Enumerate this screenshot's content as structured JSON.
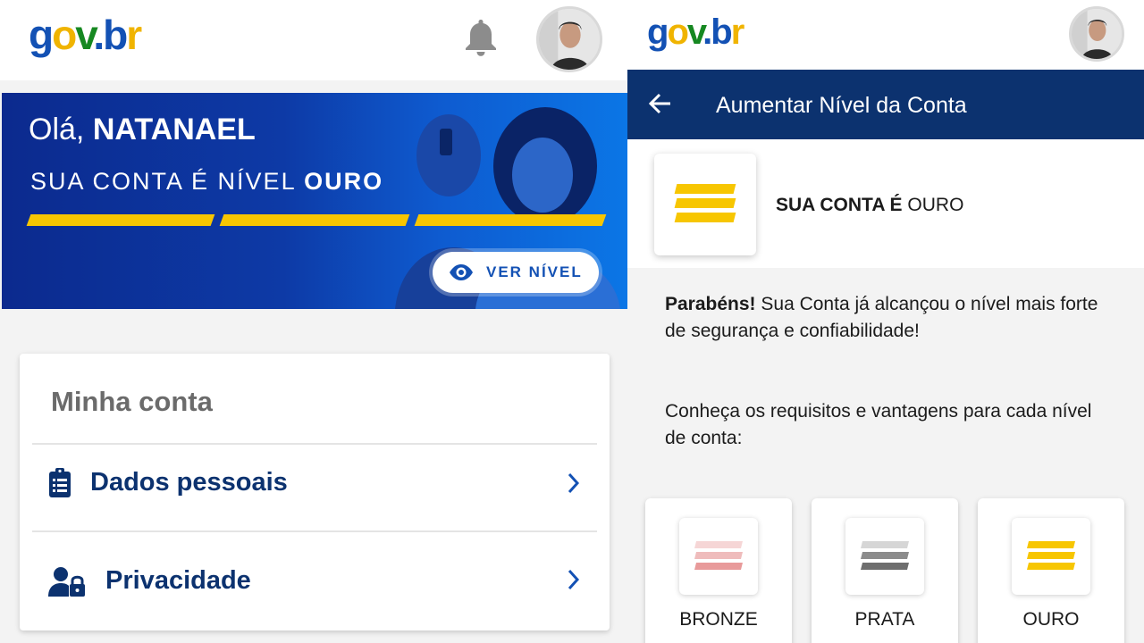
{
  "left": {
    "logo": {
      "g": "g",
      "o": "o",
      "v": "v",
      "dot": ".",
      "b": "b",
      "r": "r"
    },
    "banner": {
      "greeting_prefix": "Olá, ",
      "user_name": "NATANAEL",
      "level_prefix": "SUA CONTA É NÍVEL ",
      "level_name": "OURO",
      "button_label": "VER NÍVEL"
    },
    "card": {
      "title": "Minha conta",
      "items": [
        {
          "label": "Dados pessoais",
          "icon": "clipboard-icon"
        },
        {
          "label": "Privacidade",
          "icon": "user-lock-icon"
        }
      ]
    }
  },
  "right": {
    "logo": {
      "g": "g",
      "o": "o",
      "v": "v",
      "dot": ".",
      "b": "b",
      "r": "r"
    },
    "title": "Aumentar Nível da Conta",
    "status_prefix": "SUA CONTA É",
    "status_level": " OURO",
    "congrats_bold": "Parabéns!",
    "congrats_text": " Sua Conta já alcançou o nível mais forte de segurança e confiabilidade!",
    "info_text": "Conheça os requisitos e vantagens para cada nível de conta:",
    "levels": [
      {
        "label": "BRONZE",
        "color": "#e8a0a0"
      },
      {
        "label": "PRATA",
        "color": "#7a7a7a"
      },
      {
        "label": "OURO",
        "color": "#f7c601"
      }
    ]
  },
  "colors": {
    "primary": "#1351b4",
    "dark_blue": "#0c326f",
    "gold": "#f7c601"
  }
}
